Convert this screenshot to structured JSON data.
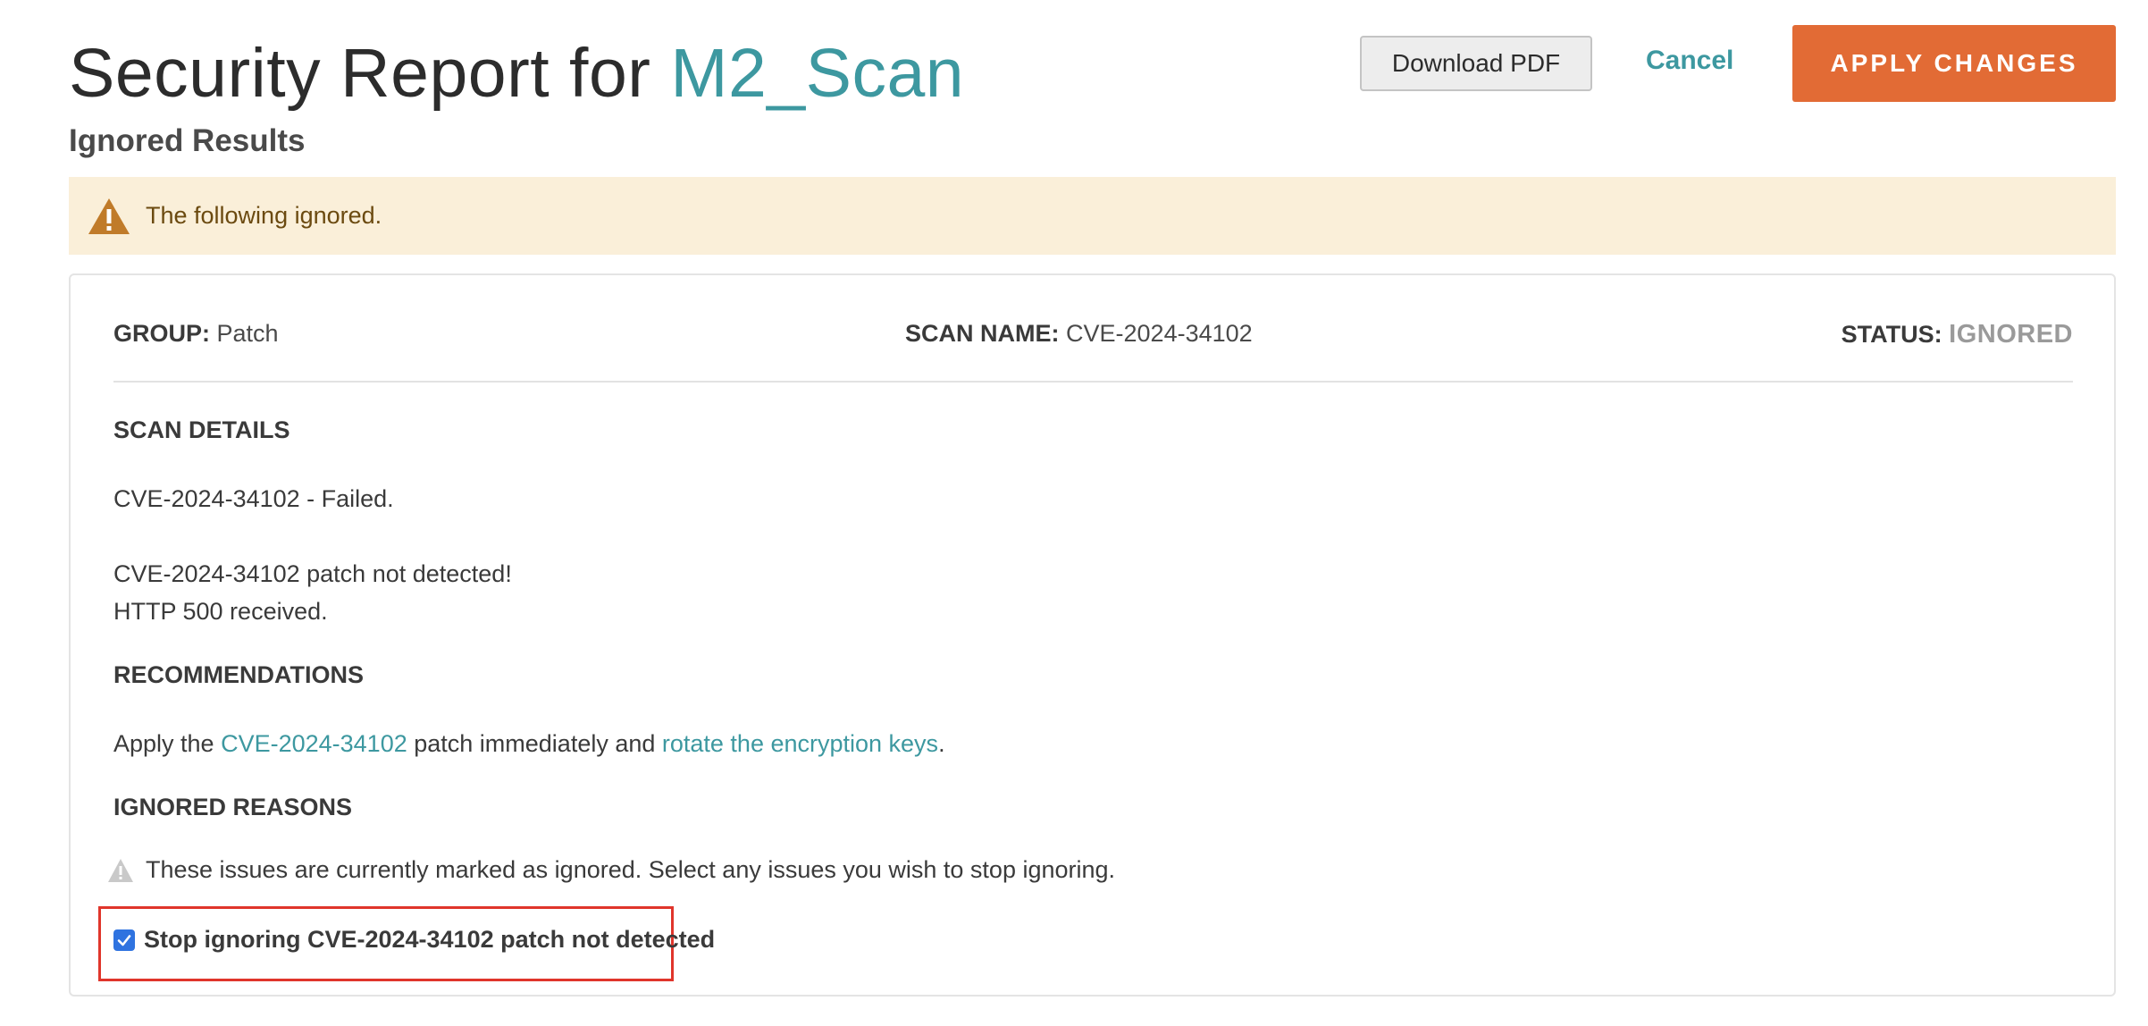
{
  "header": {
    "title_prefix": "Security Report for ",
    "title_name": "M2_Scan",
    "subtitle": "Ignored Results",
    "download_label": "Download PDF",
    "cancel_label": "Cancel",
    "apply_label": "APPLY CHANGES"
  },
  "banner": {
    "icon": "warning-triangle-icon",
    "text": "The following ignored.",
    "color": "#faefd9"
  },
  "result": {
    "group_label": "GROUP:",
    "group_value": "Patch",
    "scan_name_label": "SCAN NAME:",
    "scan_name_value": "CVE-2024-34102",
    "status_label": "STATUS:",
    "status_value": "IGNORED",
    "scan_details_heading": "SCAN DETAILS",
    "scan_details_line1": "CVE-2024-34102 - Failed.",
    "scan_details_line2": "CVE-2024-34102 patch not detected!",
    "scan_details_line3": "HTTP 500 received.",
    "recommendations_heading": "RECOMMENDATIONS",
    "rec_prefix": "Apply the ",
    "rec_link1": "CVE-2024-34102",
    "rec_middle": " patch immediately and ",
    "rec_link2": "rotate the encryption keys",
    "rec_suffix": ".",
    "ignored_reasons_heading": "IGNORED REASONS",
    "ignored_note": "These issues are currently marked as ignored. Select any issues you wish to stop ignoring.",
    "checkbox_label": "Stop ignoring CVE-2024-34102 patch not detected",
    "checkbox_checked": true
  },
  "colors": {
    "accent": "#3d98a0",
    "apply_button": "#e26b35",
    "highlight_border": "#e0352b",
    "checkbox": "#2f73e0"
  }
}
